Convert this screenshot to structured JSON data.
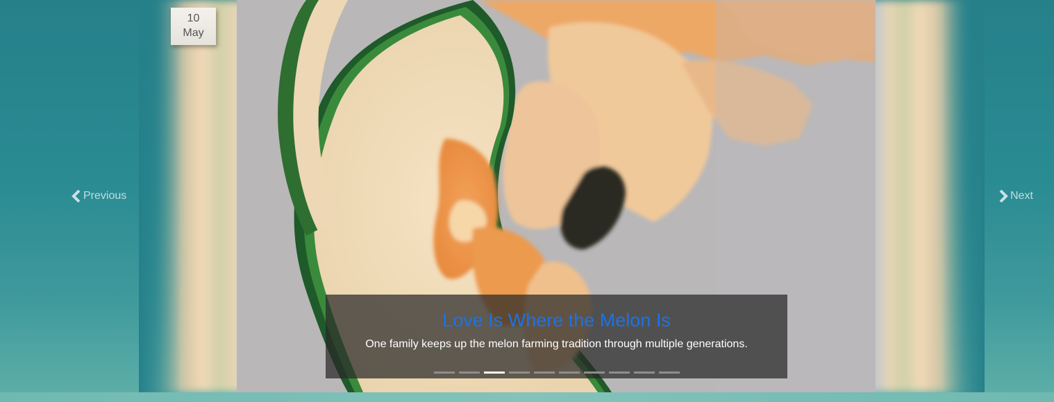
{
  "slider": {
    "date": {
      "day": "10",
      "month": "May"
    },
    "nav": {
      "previous_label": "Previous",
      "next_label": "Next"
    },
    "caption": {
      "title": "Love Is Where the Melon Is",
      "description": "One family keeps up the melon farming tradition through multiple generations."
    },
    "indicators": {
      "count": 10,
      "active_index": 2
    },
    "colors": {
      "title": "#1a73e8",
      "page_bg": "#25808a"
    }
  }
}
